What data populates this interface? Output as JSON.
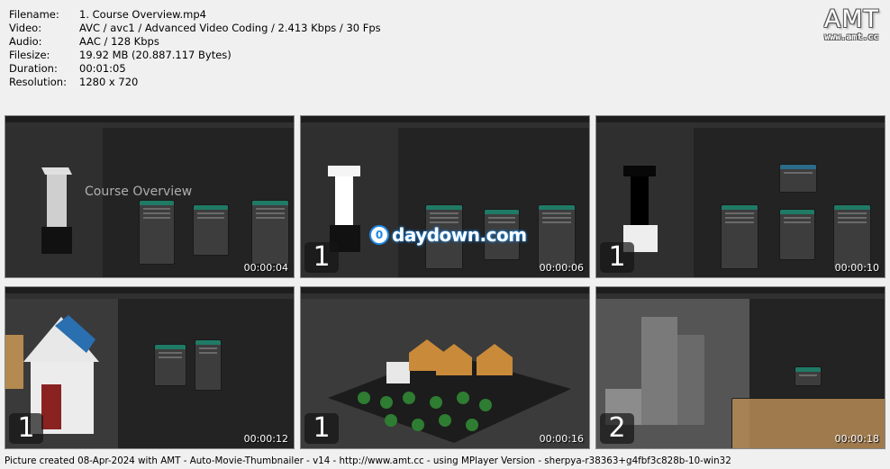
{
  "meta": {
    "rows": [
      {
        "key": "Filename:",
        "value": "1. Course Overview.mp4"
      },
      {
        "key": "Video:",
        "value": "AVC / avc1 / Advanced Video Coding / 2.413 Kbps / 30 Fps"
      },
      {
        "key": "Audio:",
        "value": "AAC / 128 Kbps"
      },
      {
        "key": "Filesize:",
        "value": "19.92 MB (20.887.117 Bytes)"
      },
      {
        "key": "Duration:",
        "value": "00:01:05"
      },
      {
        "key": "Resolution:",
        "value": "1280 x 720"
      }
    ]
  },
  "logo": {
    "text": "AMT",
    "url": "www.amt.cc"
  },
  "thumbs": [
    {
      "time": "00:00:04",
      "badge": "",
      "overlay": "Course Overview",
      "watermark": ""
    },
    {
      "time": "00:00:06",
      "badge": "1",
      "overlay": "",
      "watermark": "daydown.com"
    },
    {
      "time": "00:00:10",
      "badge": "1",
      "overlay": "",
      "watermark": ""
    },
    {
      "time": "00:00:12",
      "badge": "1",
      "overlay": "",
      "watermark": ""
    },
    {
      "time": "00:00:16",
      "badge": "1",
      "overlay": "",
      "watermark": ""
    },
    {
      "time": "00:00:18",
      "badge": "2",
      "overlay": "",
      "watermark": ""
    }
  ],
  "footer": "Picture created 08-Apr-2024 with AMT - Auto-Movie-Thumbnailer - v14 - http://www.amt.cc - using MPlayer Version - sherpya-r38363+g4fbf3c828b-10-win32"
}
